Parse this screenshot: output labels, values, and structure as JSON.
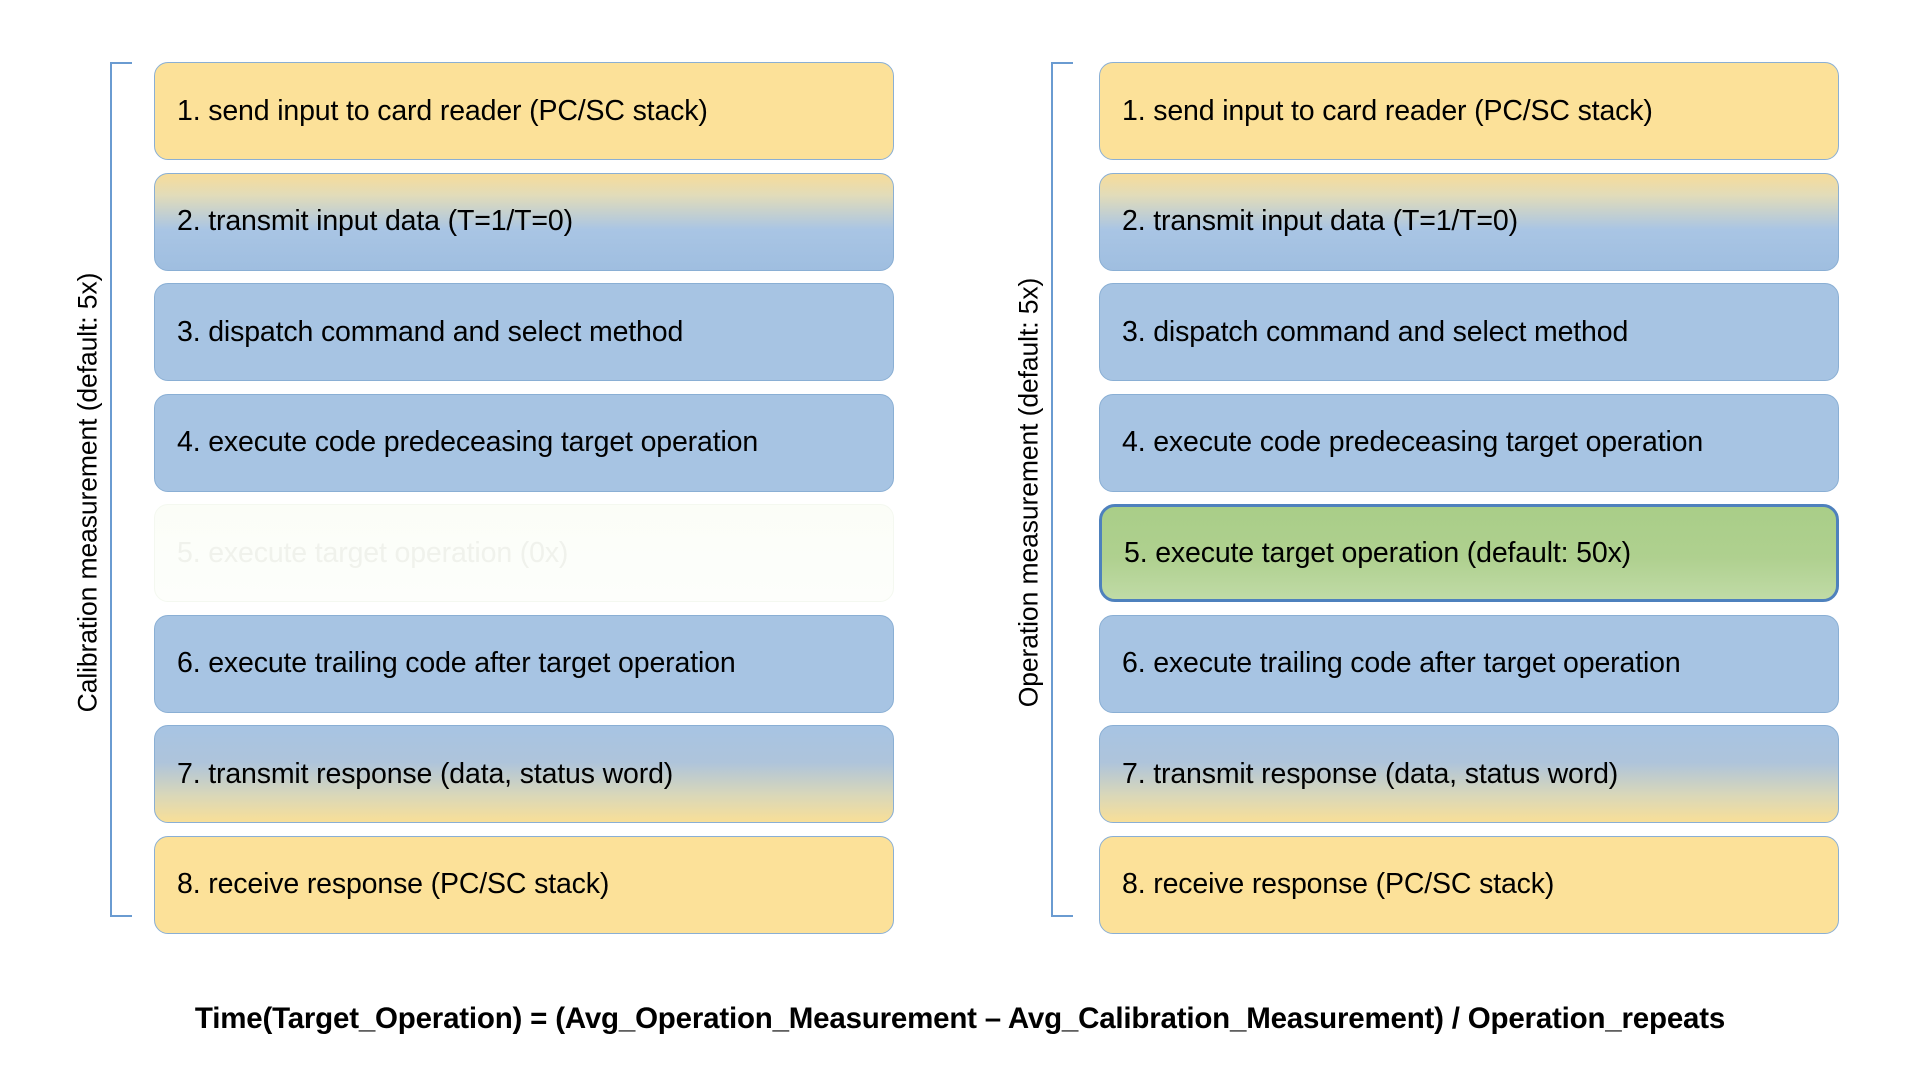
{
  "diagram": {
    "title_formula": "Time(Target_Operation) = (Avg_Operation_Measurement – Avg_Calibration_Measurement) / Operation_repeats",
    "colors": {
      "yellow": "#FCE199",
      "blue": "#A7C4E3",
      "green": "#AFD08F",
      "green_border": "#4E81BD",
      "bracket": "#6A9BD1",
      "box_border": "#8AAFD4",
      "ghost_text": "#F0F2EC"
    },
    "columns": [
      {
        "id": "calibration",
        "side_label": "Calibration measurement (default: 5x)",
        "steps": [
          {
            "label": "1. send input to card reader (PC/SC stack)",
            "style": "yellow"
          },
          {
            "label": "2. transmit input data (T=1/T=0)",
            "style": "grad-y2b"
          },
          {
            "label": "3. dispatch command and select method",
            "style": "blue"
          },
          {
            "label": "4. execute code predeceasing target operation",
            "style": "blue"
          },
          {
            "label": "5. execute target operation (0x)",
            "style": "ghost"
          },
          {
            "label": "6. execute trailing code after target operation",
            "style": "blue"
          },
          {
            "label": "7. transmit response (data, status word)",
            "style": "grad-b2y"
          },
          {
            "label": "8. receive response (PC/SC stack)",
            "style": "yellow"
          }
        ]
      },
      {
        "id": "operation",
        "side_label": "Operation measurement (default: 5x)",
        "steps": [
          {
            "label": "1. send input to card reader (PC/SC stack)",
            "style": "yellow"
          },
          {
            "label": "2. transmit input data (T=1/T=0)",
            "style": "grad-y2b"
          },
          {
            "label": "3. dispatch command and select method",
            "style": "blue"
          },
          {
            "label": "4. execute code predeceasing target operation",
            "style": "blue"
          },
          {
            "label": "5. execute target operation (default: 50x)",
            "style": "green"
          },
          {
            "label": "6. execute trailing code after target operation",
            "style": "blue"
          },
          {
            "label": "7. transmit response (data, status word)",
            "style": "grad-b2y"
          },
          {
            "label": "8. receive response (PC/SC stack)",
            "style": "yellow"
          }
        ]
      }
    ]
  }
}
